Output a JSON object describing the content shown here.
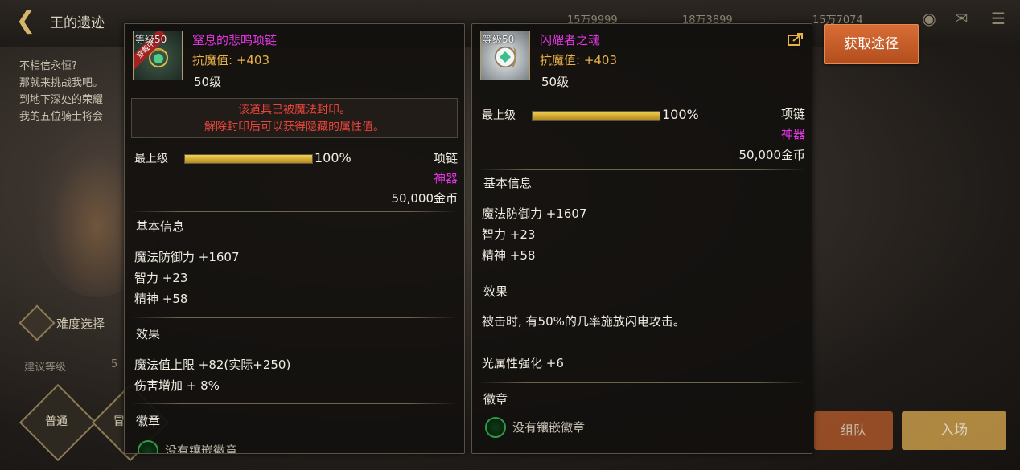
{
  "background": {
    "stage_title": "王的遗迹",
    "resources": [
      "15万9999",
      "18万3899",
      "15万7074"
    ],
    "description_lines": [
      "不相信永恒?",
      "那就来挑战我吧。",
      "到地下深处的荣耀",
      "我的五位骑士将会"
    ],
    "difficulty_label": "难度选择",
    "suggest_level_label": "建议等级",
    "suggest_level_value": "5",
    "modes": [
      "普通",
      "冒"
    ],
    "team_button": "组队",
    "enter_button": "入场"
  },
  "obtain_button": "获取途径",
  "left_item": {
    "level_tag": "等级50",
    "equipped_ribbon": "穿戴中",
    "name": "窒息的悲鸣项链",
    "stat": "抗魔值: +403",
    "level": "50级",
    "seal_line1": "该道具已被魔法封印。",
    "seal_line2": "解除封印后可以获得隐藏的属性值。",
    "max_level_label": "最上级",
    "progress_text": "100%",
    "progress_value": 1.0,
    "type": "项链",
    "rarity": "神器",
    "price": "50,000金币",
    "basic_info_title": "基本信息",
    "basic_stats": [
      "魔法防御力 +1607",
      "智力 +23",
      "精神 +58"
    ],
    "effect_title": "效果",
    "effects": [
      "魔法值上限 +82(实际+250)",
      "伤害增加 + 8%"
    ],
    "emblem_title": "徽章",
    "emblem_text": "没有镶嵌徽章"
  },
  "right_item": {
    "level_tag": "等级50",
    "name": "闪耀者之魂",
    "stat": "抗魔值: +403",
    "level": "50级",
    "max_level_label": "最上级",
    "progress_text": "100%",
    "progress_value": 1.0,
    "type": "项链",
    "rarity": "神器",
    "price": "50,000金币",
    "basic_info_title": "基本信息",
    "basic_stats": [
      "魔法防御力 +1607",
      "智力 +23",
      "精神 +58"
    ],
    "effect_title": "效果",
    "effects": [
      "被击时, 有50%的几率施放闪电攻击。",
      "光属性强化 +6"
    ],
    "emblem_title": "徽章",
    "emblem_text": "没有镶嵌徽章"
  },
  "colors": {
    "epic_name": "#e236e2",
    "stat_gold": "#e9b247",
    "seal_red": "#e8453b",
    "obtain_orange": "#c95a27"
  }
}
